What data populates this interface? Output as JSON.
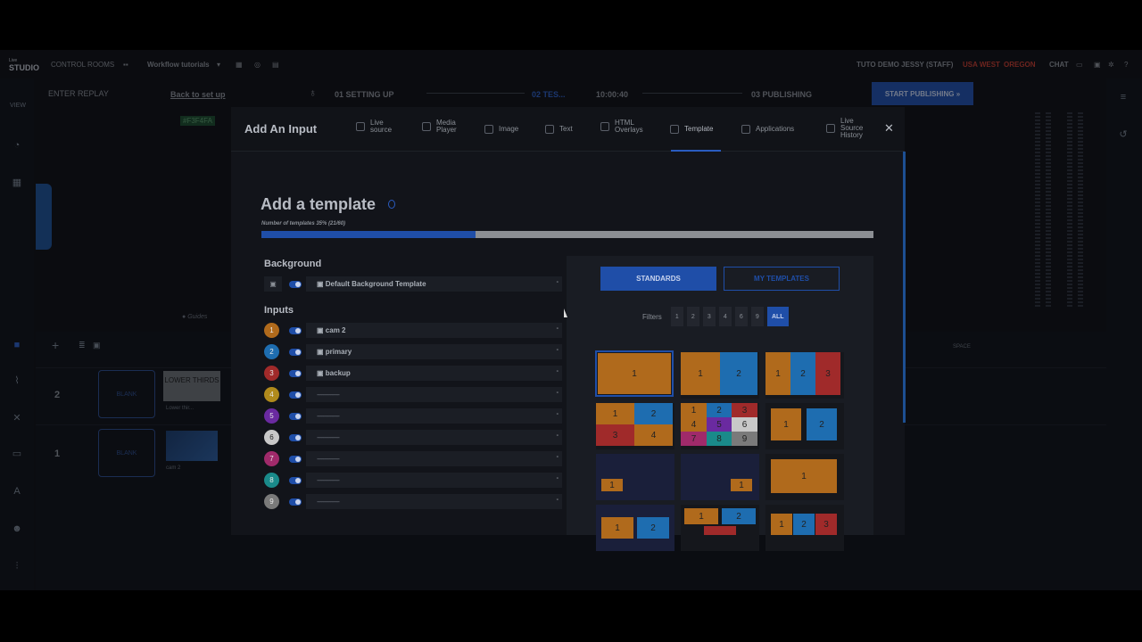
{
  "app": {
    "logo_line1": "Live",
    "logo_line2": "STUDIO",
    "control_rooms": "CONTROL ROOMS",
    "workflow": "Workflow tutorials",
    "user": "TUTO DEMO JESSY (STAFF)",
    "region_a": "USA WEST",
    "region_b": "OREGON",
    "chat": "CHAT"
  },
  "steps": {
    "enter_replay": "ENTER REPLAY",
    "back": "Back to set up",
    "s1": "01 SETTING UP",
    "s2": "02 TES...",
    "timer": "10:00:40",
    "s3": "03 PUBLISHING",
    "start": "START PUBLISHING"
  },
  "left": {
    "view": "VIEW",
    "guides": "Guides",
    "tag": "#F3F4FA"
  },
  "timeline": {
    "row2": "2",
    "row1": "1",
    "blank": "BLANK",
    "lower_thirds": "LOWER THIRDS",
    "lower_caption": "Lower thir...",
    "cam_caption": "cam 2",
    "space": "SPACE"
  },
  "modal": {
    "title": "Add An Input",
    "tabs": [
      {
        "label": "Live source",
        "icon": "live-source-icon"
      },
      {
        "label": "Media Player",
        "icon": "media-player-icon"
      },
      {
        "label": "Image",
        "icon": "image-icon"
      },
      {
        "label": "Text",
        "icon": "text-icon"
      },
      {
        "label": "HTML Overlays",
        "icon": "html-icon"
      },
      {
        "label": "Template",
        "icon": "template-icon"
      },
      {
        "label": "Applications",
        "icon": "applications-icon"
      },
      {
        "label": "Live Source History",
        "icon": "history-icon"
      }
    ],
    "close": "✕",
    "heading": "Add a template",
    "count": "Number of templates 35% (21/60)",
    "progress": 0.35,
    "background_label": "Background",
    "background_value": "Default Background Template",
    "inputs_label": "Inputs",
    "inputs": [
      {
        "n": "1",
        "color": "#b06a1c",
        "value": "cam 2"
      },
      {
        "n": "2",
        "color": "#1e6db0",
        "value": "primary"
      },
      {
        "n": "3",
        "color": "#a02a2a",
        "value": "backup"
      },
      {
        "n": "4",
        "color": "#b08a1c",
        "value": "---------------"
      },
      {
        "n": "5",
        "color": "#6a2aa0",
        "value": "---------------"
      },
      {
        "n": "6",
        "color": "#c8c8c8",
        "value": "---------------"
      },
      {
        "n": "7",
        "color": "#a02a6a",
        "value": "---------------"
      },
      {
        "n": "8",
        "color": "#1a8a8a",
        "value": "---------------"
      },
      {
        "n": "9",
        "color": "#7a7a7a",
        "value": "---------------"
      }
    ],
    "standards": "STANDARDS",
    "my_templates": "MY TEMPLATES",
    "filters_label": "Filters",
    "filters": [
      "1",
      "2",
      "3",
      "4",
      "6",
      "9",
      "ALL"
    ]
  }
}
